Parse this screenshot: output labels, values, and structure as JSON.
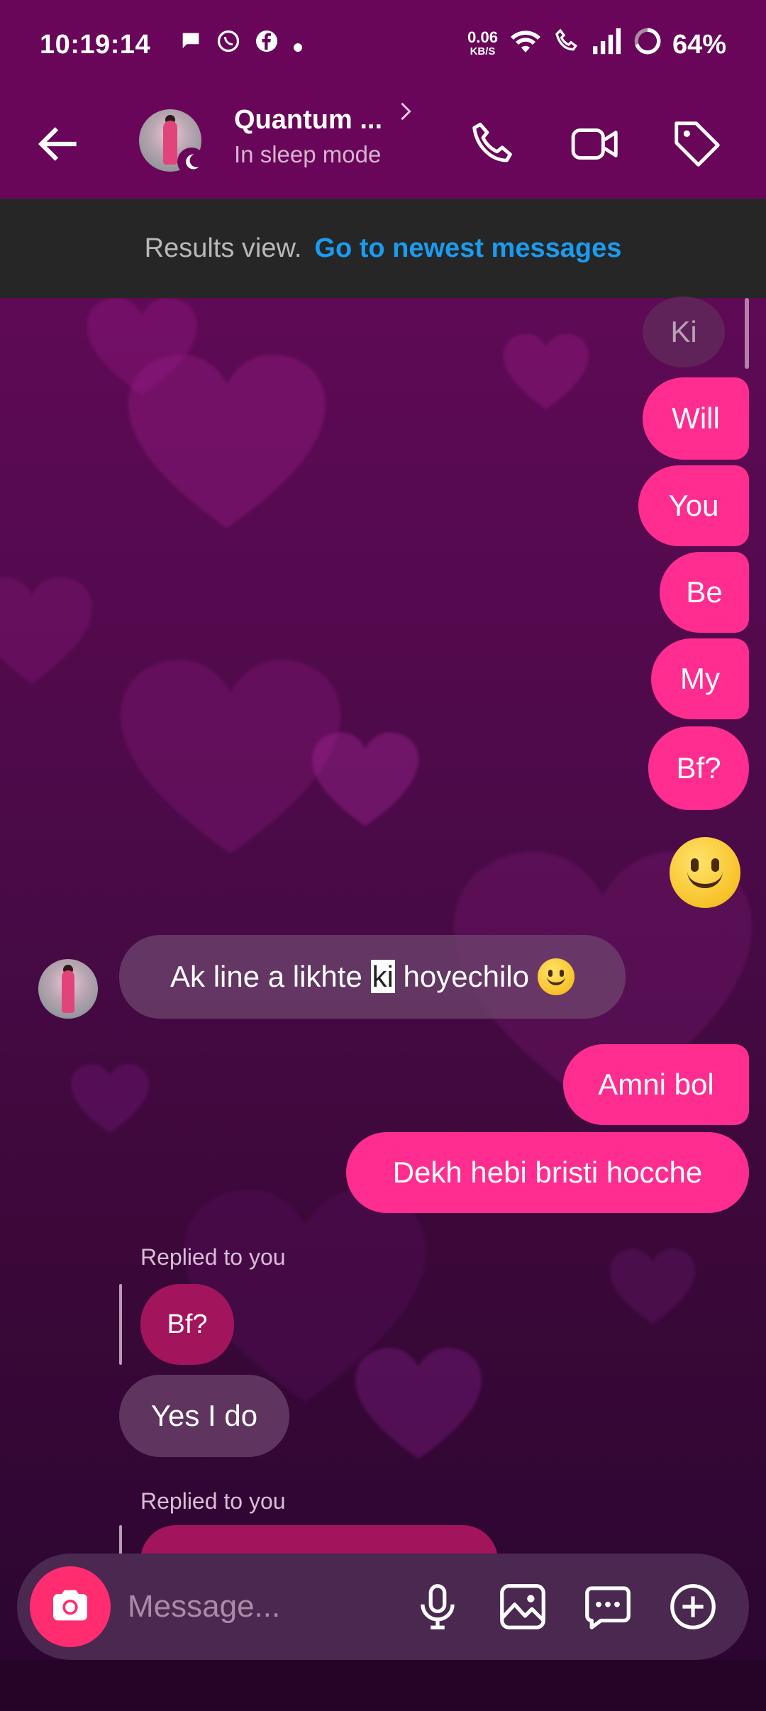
{
  "status_bar": {
    "time": "10:19:14",
    "net_speed_value": "0.06",
    "net_speed_unit": "KB/S",
    "battery": "64%"
  },
  "header": {
    "contact_name": "Quantum ...",
    "contact_status": "In sleep mode"
  },
  "results_banner": {
    "label": "Results view.",
    "link": "Go to newest messages"
  },
  "messages": {
    "ghost": "Ki",
    "out_1": "Will",
    "out_2": "You",
    "out_3": "Be",
    "out_4": "My",
    "out_5": "Bf?",
    "in_1_before": "Ak line a likhte ",
    "in_1_highlight": "ki",
    "in_1_after": " hoyechilo",
    "out_6": "Amni bol",
    "out_7": "Dekh hebi bristi hocche",
    "reply_label_1": "Replied to you",
    "quoted_1": "Bf?",
    "in_2": "Yes I do",
    "reply_label_2": "Replied to you"
  },
  "composer": {
    "placeholder": "Message..."
  },
  "colors": {
    "accent_pink": "#ff2d8f",
    "header_bg": "#690659",
    "link_blue": "#1a9cf0"
  }
}
